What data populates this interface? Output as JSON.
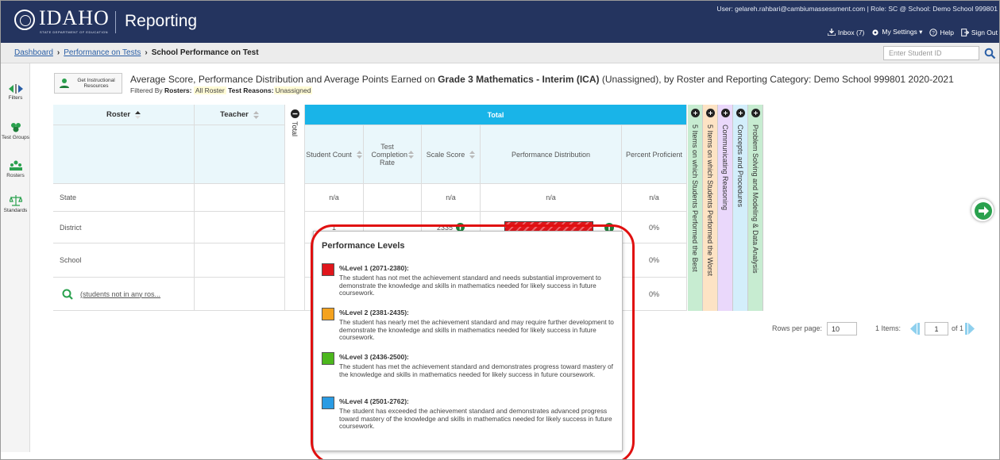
{
  "app": {
    "logo_text": "IDAHO",
    "logo_subtitle": "STATE DEPARTMENT OF EDUCATION",
    "title": "Reporting",
    "user_line": "User: gelareh.rahbari@cambiumassessment.com  |  Role: SC @ School: Demo School 999801",
    "actions": {
      "inbox": "Inbox (7)",
      "settings": "My Settings ▾",
      "help": "Help",
      "signout": "Sign Out"
    }
  },
  "breadcrumb": {
    "items": [
      "Dashboard",
      "Performance on Tests"
    ],
    "current": "School Performance on Test"
  },
  "student_search": {
    "placeholder": "Enter Student ID"
  },
  "rail": [
    {
      "label": "Filters",
      "icon": "filter-arrows-icon"
    },
    {
      "label": "Test Groups",
      "icon": "test-groups-icon"
    },
    {
      "label": "Rosters",
      "icon": "rosters-icon"
    },
    {
      "label": "Standards",
      "icon": "standards-scale-icon"
    }
  ],
  "instructional_button": {
    "line1": "Get Instructional",
    "line2": "Resources"
  },
  "heading": {
    "prefix": "Average Score, Performance Distribution and Average Points Earned on ",
    "test": "Grade 3 Mathematics - Interim (ICA)",
    "suffix": " (Unassigned), by Roster and Reporting Category: Demo School 999801 2020-2021"
  },
  "filters": {
    "prefix": "Filtered By",
    "rosters_label": "Rosters:",
    "rosters_value": "All Roster",
    "reasons_label": "Test Reasons:",
    "reasons_value": "Unassigned"
  },
  "table": {
    "col_roster": "Roster",
    "col_teacher": "Teacher",
    "col_total_collapsed": "Total",
    "group_total": "Total",
    "sub_student_count": "Student Count",
    "sub_completion": "Test Completion Rate",
    "sub_scale": "Scale Score",
    "sub_distribution": "Performance Distribution",
    "sub_proficient": "Percent Proficient",
    "rows": [
      {
        "roster": "State",
        "count": "n/a",
        "scale": "n/a",
        "dist": "n/a",
        "prof": "n/a"
      },
      {
        "roster": "District",
        "count": "1",
        "scale": "2335",
        "dist": "",
        "prof": "0%"
      },
      {
        "roster": "School",
        "count": "",
        "scale": "",
        "dist": "",
        "prof": "0%"
      },
      {
        "roster": "(students not in any ros...",
        "count": "",
        "scale": "",
        "dist": "",
        "prof": "0%"
      }
    ],
    "category_columns": [
      {
        "label": "5 Items on which Students Performed the Best",
        "color": "#c7ecd1"
      },
      {
        "label": "5 Items on which Students Performed the Worst",
        "color": "#fde3c4"
      },
      {
        "label": "Communicating Reasoning",
        "color": "#ead8fb"
      },
      {
        "label": "Concepts and Procedures",
        "color": "#d3eefb"
      },
      {
        "label": "Problem Solving and Modeling & Data Analysis",
        "color": "#c7ecd1"
      }
    ]
  },
  "pager": {
    "rows_label": "Rows per page:",
    "rows_value": "10",
    "items": "1 Items:",
    "page": "1",
    "of": "of 1"
  },
  "popup": {
    "title": "Performance Levels",
    "levels": [
      {
        "name": "%Level 1 (2071-2380):",
        "color": "#e0161c",
        "desc": "The student has not met the achievement standard and needs substantial improvement to demonstrate the knowledge and skills in mathematics needed for likely success in future coursework."
      },
      {
        "name": "%Level 2 (2381-2435):",
        "color": "#f4a21f",
        "desc": "The student has nearly met the achievement standard and may require further development to demonstrate the knowledge and skills in mathematics needed for likely success in future coursework."
      },
      {
        "name": "%Level 3 (2436-2500):",
        "color": "#4cb71d",
        "desc": "The student has met the achievement standard and demonstrates progress toward mastery of the knowledge and skills in mathematics needed for likely success in future coursework."
      },
      {
        "name": "%Level 4 (2501-2762):",
        "color": "#2a9be3",
        "desc": "The student has exceeded the achievement standard and demonstrates advanced progress toward mastery of the knowledge and skills in mathematics needed for likely success in future coursework."
      }
    ]
  }
}
